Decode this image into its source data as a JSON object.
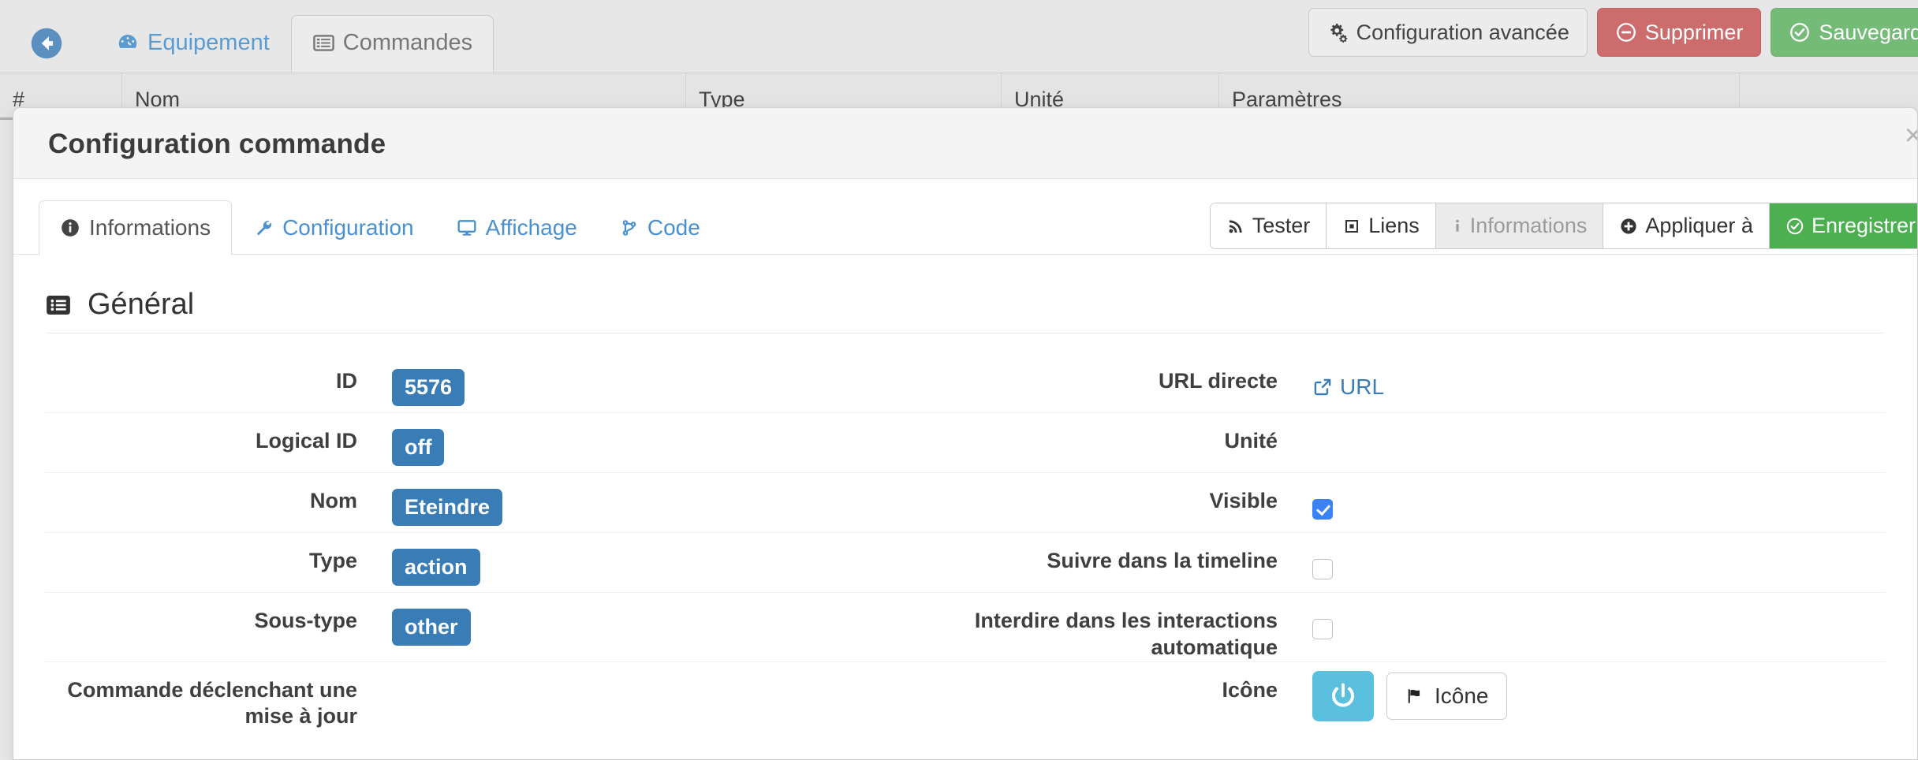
{
  "topbar": {
    "back_icon": "arrow-circle-left-icon",
    "tabs": [
      {
        "label": "Equipement",
        "icon": "dashboard-icon",
        "active": false
      },
      {
        "label": "Commandes",
        "icon": "list-alt-icon",
        "active": true
      }
    ],
    "actions": [
      {
        "label": "Configuration avancée",
        "icon": "cogs-icon",
        "style": "default"
      },
      {
        "label": "Supprimer",
        "icon": "minus-circle-icon",
        "style": "danger"
      },
      {
        "label": "Sauvegarder",
        "icon": "check-circle-icon",
        "style": "success"
      }
    ]
  },
  "background_table": {
    "columns": [
      "#",
      "Nom",
      "Type",
      "Unité",
      "Paramètres",
      ""
    ]
  },
  "modal": {
    "title": "Configuration commande",
    "close_label": "×",
    "tabs": [
      {
        "label": "Informations",
        "icon": "info-circle-icon",
        "active": true
      },
      {
        "label": "Configuration",
        "icon": "wrench-icon",
        "active": false
      },
      {
        "label": "Affichage",
        "icon": "desktop-icon",
        "active": false
      },
      {
        "label": "Code",
        "icon": "code-branch-icon",
        "active": false
      }
    ],
    "tab_actions": [
      {
        "label": "Tester",
        "icon": "rss-icon",
        "style": "normal"
      },
      {
        "label": "Liens",
        "icon": "sitemap-icon",
        "style": "normal"
      },
      {
        "label": "Informations",
        "icon": "info-icon",
        "style": "disabled"
      },
      {
        "label": "Appliquer à",
        "icon": "plus-circle-icon",
        "style": "normal"
      },
      {
        "label": "Enregistrer",
        "icon": "check-circle-icon",
        "style": "green"
      }
    ],
    "section": {
      "title": "Général",
      "icon": "list-box-icon"
    },
    "form": {
      "left": [
        {
          "label": "ID",
          "value": "5576",
          "control": "badge"
        },
        {
          "label": "Logical ID",
          "value": "off",
          "control": "badge"
        },
        {
          "label": "Nom",
          "value": "Eteindre",
          "control": "badge"
        },
        {
          "label": "Type",
          "value": "action",
          "control": "badge"
        },
        {
          "label": "Sous-type",
          "value": "other",
          "control": "badge"
        },
        {
          "label": "Commande déclenchant une mise à jour",
          "value": "",
          "control": "empty"
        }
      ],
      "right": [
        {
          "label": "URL directe",
          "value": "URL",
          "control": "link",
          "icon": "external-link-icon"
        },
        {
          "label": "Unité",
          "value": "",
          "control": "empty"
        },
        {
          "label": "Visible",
          "value": "",
          "control": "checkbox",
          "checked": true
        },
        {
          "label": "Suivre dans la timeline",
          "value": "",
          "control": "checkbox",
          "checked": false
        },
        {
          "label": "Interdire dans les interactions automatique",
          "value": "",
          "control": "checkbox",
          "checked": false
        },
        {
          "label": "Icône",
          "value": "Icône",
          "control": "icon-picker",
          "preview_icon": "power-icon",
          "button_icon": "flag-icon"
        }
      ]
    }
  },
  "colors": {
    "accent_blue": "#3a7cb5",
    "link_blue": "#4a90cf",
    "danger": "#cd6c6c",
    "success": "#74bb78",
    "enregistrer_green": "#4caf50",
    "checkbox_checked": "#3b82f6",
    "icon_preview": "#5bc0de"
  }
}
